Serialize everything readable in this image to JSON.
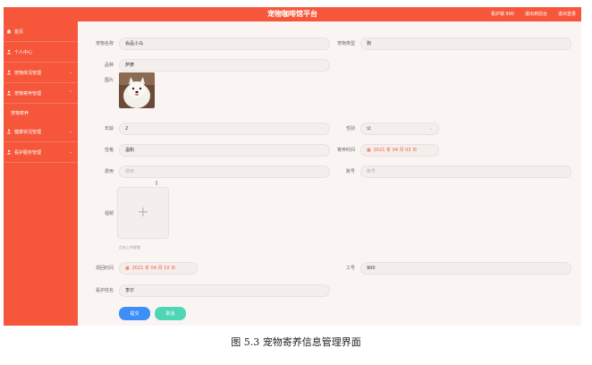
{
  "header": {
    "title": "宠物咖啡馆平台",
    "user_label": "看护端 900",
    "link_exit_ui": "退出到前台",
    "link_logout": "退出登录"
  },
  "sidebar": {
    "items": [
      {
        "label": "首页",
        "icon": "home-icon"
      },
      {
        "label": "个人中心",
        "icon": "person-icon"
      },
      {
        "label": "宠物体况管理",
        "icon": "person-icon"
      },
      {
        "label": "宠物寄养管理",
        "icon": "person-icon"
      },
      {
        "label": "健康状况管理",
        "icon": "person-icon"
      },
      {
        "label": "看护服务管理",
        "icon": "person-icon"
      }
    ],
    "sub_item": "宠物寄养"
  },
  "form": {
    "pet_name": {
      "label": "宠物名称",
      "value": "会品小马"
    },
    "pet_type": {
      "label": "宠物类型",
      "value": "狗"
    },
    "breed": {
      "label": "品种",
      "value": "萨摩"
    },
    "image": {
      "label": "图片"
    },
    "age": {
      "label": "年龄",
      "value": "2"
    },
    "gender": {
      "label": "性别",
      "value": "公"
    },
    "temperament": {
      "label": "性格",
      "value": "温和"
    },
    "foster_time": {
      "label": "寄养时间",
      "value": "2021 年 04 月 03 日"
    },
    "fee": {
      "label": "费用",
      "placeholder": "费用"
    },
    "account": {
      "label": "账号",
      "placeholder": "账号"
    },
    "video": {
      "label": "视频",
      "hint": "点击上传视频"
    },
    "care_time": {
      "label": "领回时间",
      "value": "2021 年 04 月 10 日"
    },
    "job_no": {
      "label": "工号",
      "value": "900"
    },
    "caretaker": {
      "label": "看护姓名",
      "value": "李尔"
    },
    "submit_label": "提交",
    "cancel_label": "取消"
  },
  "caption": "图 5.3  宠物寄养信息管理界面",
  "colors": {
    "primary": "#f6573b",
    "submit": "#3d8ef8",
    "cancel": "#4fd6b4"
  }
}
